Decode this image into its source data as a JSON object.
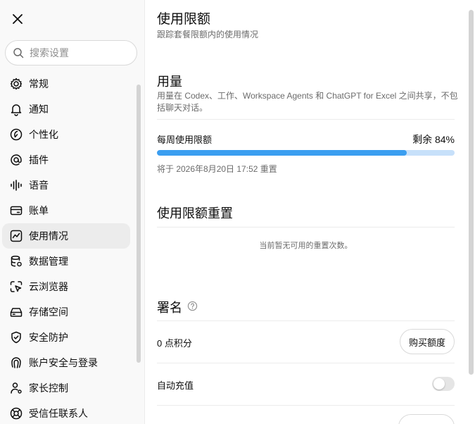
{
  "sidebar": {
    "search_placeholder": "搜索设置",
    "items": [
      {
        "label": "常规",
        "icon": "gear-icon"
      },
      {
        "label": "通知",
        "icon": "bell-icon"
      },
      {
        "label": "个性化",
        "icon": "personalization-icon"
      },
      {
        "label": "插件",
        "icon": "at-sign-icon"
      },
      {
        "label": "语音",
        "icon": "waveform-icon"
      },
      {
        "label": "账单",
        "icon": "credit-card-icon"
      },
      {
        "label": "使用情况",
        "icon": "chart-icon",
        "active": true
      },
      {
        "label": "数据管理",
        "icon": "database-icon"
      },
      {
        "label": "云浏览器",
        "icon": "cloud-browser-icon"
      },
      {
        "label": "存储空间",
        "icon": "storage-icon"
      },
      {
        "label": "安全防护",
        "icon": "shield-icon"
      },
      {
        "label": "账户安全与登录",
        "icon": "fingerprint-icon"
      },
      {
        "label": "家长控制",
        "icon": "parental-icon"
      },
      {
        "label": "受信任联系人",
        "icon": "lifebuoy-icon"
      }
    ]
  },
  "main": {
    "title": "使用限额",
    "subtitle": "跟踪套餐限额内的使用情况",
    "usage": {
      "title": "用量",
      "description": "用量在 Codex、工作、Workspace Agents 和 ChatGPT for Excel 之间共享，不包括聊天对话。",
      "weekly_label": "每周使用限额",
      "remaining": "剩余 84%",
      "progress_percent": 84,
      "reset_text": "将于 2026年8月20日 17:52 重置"
    },
    "reset_section": {
      "title": "使用限额重置",
      "empty_message": "当前暂无可用的重置次数。"
    },
    "signature": {
      "title": "署名",
      "credits": "0 点积分",
      "buy_button": "购买额度",
      "auto_recharge": "自动充值",
      "auto_recharge_on": false
    }
  },
  "colors": {
    "progress_fill": "#3b9ef0",
    "progress_track": "#c7e0fa"
  }
}
